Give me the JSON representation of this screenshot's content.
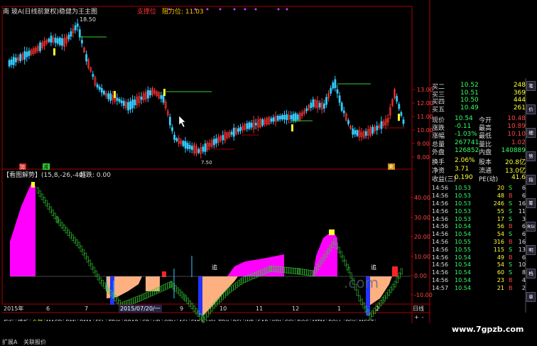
{
  "header": {
    "title": "南 玻A(日线前复权)稳健为王主图",
    "support_label": "支撑位",
    "resist_label": "阻力位: 11.03"
  },
  "price_chart": {
    "high_mark": "18.50",
    "low_mark": "7.50",
    "marker_reduce": "减",
    "marker_add": "加",
    "marker_sell": "卖",
    "y_ticks": [
      "13.00",
      "12.00",
      "11.00",
      "10.00",
      "9.00",
      "8.00"
    ]
  },
  "indicator": {
    "title": "【看图解势】(15,8,-26,-40)",
    "overbought": "超跌: 0.00",
    "marker_chase_1": "追",
    "marker_chase_2": "追",
    "y_ticks": [
      "40.00",
      "30.00",
      "20.00",
      "10.00",
      "0.00",
      "-10.00"
    ]
  },
  "time_axis": {
    "labels": [
      "2015年",
      "6",
      "7",
      "2015/07/20/一",
      "9",
      "10",
      "11",
      "12",
      "1",
      "2"
    ],
    "period": "日线"
  },
  "bottom_tabs": [
    "指标",
    "模板",
    "全部",
    "MACD",
    "DMI",
    "DMA",
    "FSL",
    "TRIX",
    "BRAR",
    "CR",
    "VR",
    "OBV",
    "ASI",
    "EMV",
    "VOL-TDX",
    "RSI",
    "WR",
    "SAR",
    "KDJ",
    "CCI",
    "ROC",
    "MTM",
    "BOLL",
    "PSY",
    "MCST"
  ],
  "status_bar": [
    "扩展A",
    "关联报价"
  ],
  "quote": {
    "order_book": [
      {
        "label": "买二",
        "price": "10.52",
        "vol": "248"
      },
      {
        "label": "买三",
        "price": "10.51",
        "vol": "369"
      },
      {
        "label": "买四",
        "price": "10.50",
        "vol": "444"
      },
      {
        "label": "买五",
        "price": "10.49",
        "vol": "261"
      }
    ],
    "stats": [
      {
        "l1": "现价",
        "v1": "10.54",
        "l2": "今开",
        "v2": "10.48"
      },
      {
        "l1": "涨跌",
        "v1": "-0.11",
        "l2": "最高",
        "v2": "10.89"
      },
      {
        "l1": "涨幅",
        "v1": "-1.03%",
        "l2": "最低",
        "v2": "10.10"
      },
      {
        "l1": "总量",
        "v1": "267741",
        "l2": "量比",
        "v2": "1.02"
      },
      {
        "l1": "外盘",
        "v1": "126852",
        "l2": "内盘",
        "v2": "140889"
      }
    ],
    "fund": [
      {
        "l1": "换手",
        "v1": "2.06%",
        "l2": "股本",
        "v2": "20.8亿"
      },
      {
        "l1": "净资",
        "v1": "3.71",
        "l2": "流通",
        "v2": "13.0亿"
      },
      {
        "l1": "收益(三)",
        "v1": "0.190",
        "l2": "PE(动)",
        "v2": "41.6"
      }
    ],
    "ticks": [
      {
        "t": "14:56",
        "p": "10.53",
        "v": "20",
        "d": "S",
        "n": "6"
      },
      {
        "t": "14:56",
        "p": "10.53",
        "v": "48",
        "d": "B",
        "n": "6"
      },
      {
        "t": "14:56",
        "p": "10.53",
        "v": "246",
        "d": "S",
        "n": "16"
      },
      {
        "t": "14:56",
        "p": "10.53",
        "v": "55",
        "d": "S",
        "n": "11"
      },
      {
        "t": "14:56",
        "p": "10.53",
        "v": "17",
        "d": "S",
        "n": "3"
      },
      {
        "t": "14:56",
        "p": "10.54",
        "v": "56",
        "d": "B",
        "n": "6"
      },
      {
        "t": "14:56",
        "p": "10.54",
        "v": "54",
        "d": "S",
        "n": "6"
      },
      {
        "t": "14:56",
        "p": "10.55",
        "v": "316",
        "d": "B",
        "n": "16"
      },
      {
        "t": "14:56",
        "p": "10.55",
        "v": "115",
        "d": "S",
        "n": "13"
      },
      {
        "t": "14:56",
        "p": "10.54",
        "v": "49",
        "d": "B",
        "n": "6"
      },
      {
        "t": "14:56",
        "p": "10.54",
        "v": "54",
        "d": "S",
        "n": "10"
      },
      {
        "t": "14:56",
        "p": "10.54",
        "v": "60",
        "d": "S",
        "n": "8"
      },
      {
        "t": "14:56",
        "p": "10.54",
        "v": "23",
        "d": "B",
        "n": "4"
      },
      {
        "t": "14:57",
        "p": "10.54",
        "v": "21",
        "d": "B",
        "n": "2"
      }
    ]
  },
  "side_tabs": [
    "笔",
    "价",
    "细",
    "势",
    "指",
    "筹",
    "RSI",
    "明",
    "档",
    "单"
  ],
  "watermark": "www.7gpzb.com",
  "colors": {
    "up": "#ff3333",
    "down": "#33ccff",
    "magenta": "#ff00ff",
    "peach": "#ffb080",
    "green_line": "#33cc33",
    "yellow": "#ffff00",
    "blue": "#2233ff"
  }
}
